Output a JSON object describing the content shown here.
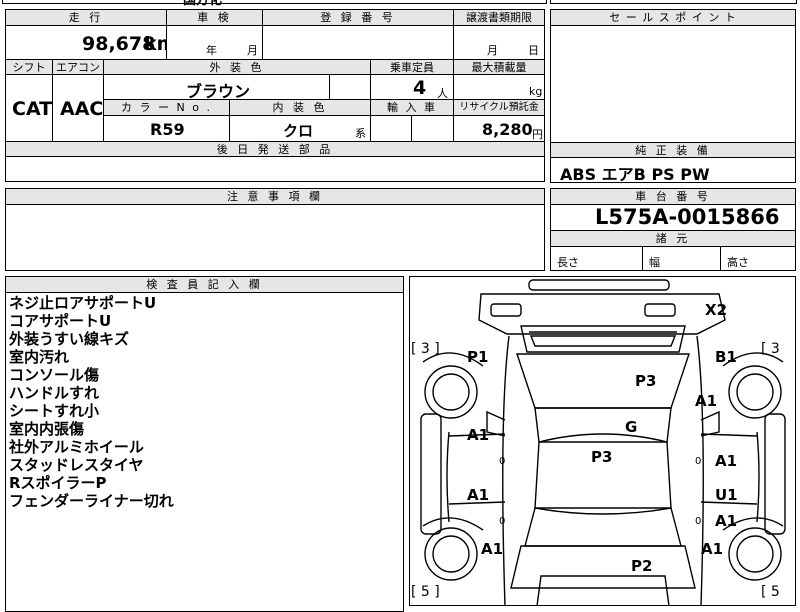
{
  "top_strip": {
    "partial_text": "国方化"
  },
  "mileage": {
    "header": "走 行",
    "value": "98,678",
    "unit": "km"
  },
  "inspection": {
    "header": "車 検",
    "year_label": "年",
    "month_label": "月"
  },
  "registration": {
    "header": "登 録 番 号"
  },
  "transfer_deadline": {
    "header": "譲渡書類期限",
    "month_label": "月",
    "day_label": "日"
  },
  "sales_point": {
    "header": "セ ー ル ス ポ イ ン ト"
  },
  "shift": {
    "header": "シフト",
    "value": "CAT"
  },
  "aircon": {
    "header": "エアコン",
    "value": "AAC"
  },
  "exterior_color": {
    "header": "外 装 色",
    "value": "ブラウン"
  },
  "capacity": {
    "header": "乗車定員",
    "value": "4",
    "unit": "人"
  },
  "max_load": {
    "header": "最大積載量",
    "unit": "kg"
  },
  "color_no": {
    "header": "カ ラ ー N o .",
    "value": "R59"
  },
  "interior_color": {
    "header": "内 装 色",
    "value": "クロ",
    "suffix": "系"
  },
  "import": {
    "header": "輸 入 車"
  },
  "recycle": {
    "header": "リサイクル預託金",
    "value": "8,280",
    "unit": "円"
  },
  "later_parts": {
    "header": "後 日 発 送 部 品"
  },
  "genuine_equipment": {
    "header": "純 正 装 備",
    "value": "ABS エアB PS PW"
  },
  "notes": {
    "header": "注 意 事 項 欄"
  },
  "chassis": {
    "header": "車 台 番 号",
    "value": "L575A-0015866"
  },
  "specs": {
    "header": "諸 元",
    "length_label": "長さ",
    "width_label": "幅",
    "height_label": "高さ"
  },
  "inspector": {
    "header": "検 査 員 記 入 欄",
    "lines": [
      "ネジ止ロアサポートU",
      "コアサポートU",
      "外装うすい線キズ",
      "室内汚れ",
      "コンソール傷",
      "ハンドルすれ",
      "シートすれ小",
      "室内内張傷",
      "社外アルミホイール",
      "スタッドレスタイヤ",
      "RスポイラーP",
      "フェンダーライナー切れ"
    ]
  },
  "diagram": {
    "marks": {
      "x2": "X2",
      "p1": "P1",
      "b1": "B1",
      "p3_upper": "P3",
      "a1_right_upper": "A1",
      "g": "G",
      "a1_left_front": "A1",
      "p3_center": "P3",
      "a1_right_front": "A1",
      "a1_left_rear": "A1",
      "u1": "U1",
      "a1_right_rear": "A1",
      "a1_left_bottom": "A1",
      "p2": "P2",
      "a1_right_bottom": "A1"
    },
    "tire_tags": {
      "front_left": "[ 3 ]",
      "front_right": "[ 3",
      "rear_left": "[ 5 ]",
      "rear_right": "[ 5"
    },
    "door_marks": {
      "left_front": "0",
      "right_front": "0",
      "left_rear": "0",
      "right_rear": "0"
    }
  }
}
